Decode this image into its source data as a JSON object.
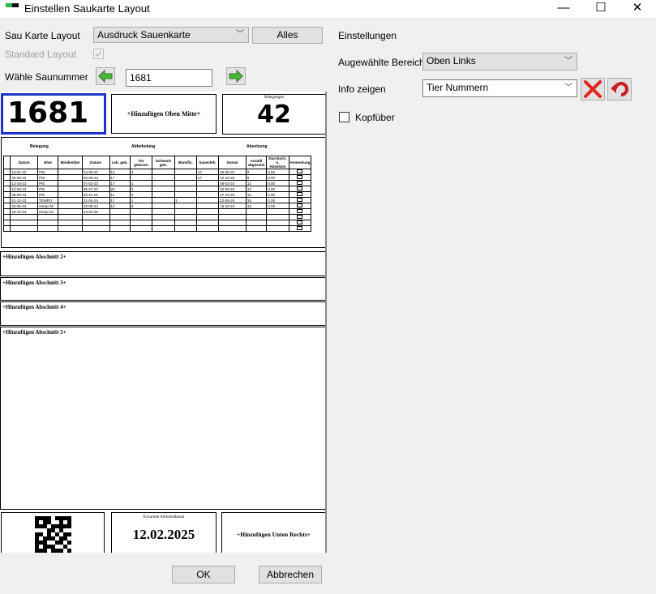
{
  "window": {
    "title": "Einstellen Saukarte Layout",
    "min": "—",
    "max": "☐",
    "close": "✕"
  },
  "left": {
    "layout_label": "Sau Karte Layout",
    "layout_value": "Ausdruck Sauenkarte",
    "alles": "Alles",
    "standard_label": "Standard Layout",
    "choose_label": "Wähle Saunummer",
    "sow_number": "1681"
  },
  "right": {
    "settings_label": "Einstellungen",
    "area_label": "Augewählte Bereiche",
    "area_value": "Oben Links",
    "info_label": "Info zeigen",
    "info_value": "Tier Nummern",
    "flip_label": "Kopfüber"
  },
  "card": {
    "top_left": "1681",
    "top_center": "+Hinzufügen Oben Mitte+",
    "top_right_caption": "Belegungen",
    "top_right_value": "42",
    "table": {
      "groups": [
        "Belegung",
        "Abferkelung",
        "Absetzung"
      ],
      "headers": [
        "Datum",
        "Eber",
        "Mindestber",
        "Datum",
        "Leb. geb.",
        "Tot geboren",
        "Schwach geb.",
        "Mumifiz.",
        "Sauenfeh.",
        "Datum",
        "Anzahl abgesetzt",
        "Durchsch. n. Absetzen",
        "Anmerkung"
      ],
      "rows": [
        [
          "10-01-22",
          "PIE",
          "",
          "04-05-22",
          "12",
          "4",
          "",
          "",
          "12",
          "25-05-22",
          "8",
          "6.65"
        ],
        [
          "30-05-22",
          "PIE",
          "",
          "20-09-22",
          "17",
          "",
          "",
          "",
          "17",
          "12-10-22",
          "9",
          "8.00"
        ],
        [
          "13-10-22",
          "PIE",
          "",
          "07-02-23",
          "17",
          "1",
          "",
          "",
          "",
          "08-03-23",
          "11",
          "0.00"
        ],
        [
          "12-03-23",
          "PIE",
          "",
          "05-07-23",
          "20",
          "3",
          "",
          "",
          "",
          "02-08-23",
          "13",
          "0.00"
        ],
        [
          "08-08-23",
          "PIE",
          "",
          "28-11-23",
          "11",
          "4",
          "",
          "",
          "",
          "27-12-23",
          "13",
          "0.00"
        ],
        [
          "31-12-23",
          "TEMPO",
          "",
          "21-04-24",
          "17",
          "1",
          "",
          "1",
          "",
          "22-05-24",
          "15",
          "0.00"
        ],
        [
          "26-05-24",
          "tempo M",
          "",
          "18-09-24",
          "13",
          "3",
          "",
          "",
          "",
          "16-10-24",
          "15",
          "0.00"
        ],
        [
          "20-10-24",
          "tempo M",
          "",
          "13-02-25",
          "",
          "",
          "",
          "",
          "",
          "",
          "",
          ""
        ]
      ]
    },
    "sections": [
      "+Hinzufügen Abschnitt 2+",
      "+Hinzufügen Abschnitt 3+",
      "+Hinzufügen Abschnitt 4+",
      "+Hinzufügen Abschnitt 5+"
    ],
    "bottom_center_caption": "Erwartete Abferkeldatum",
    "bottom_center_value": "12.02.2025",
    "bottom_right": "+Hinzufügen Unten Rechts+"
  },
  "buttons": {
    "ok": "OK",
    "cancel": "Abbrechen"
  },
  "colors": {
    "selection_border": "#1f32c8",
    "arrow_green": "#49b33b",
    "delete_red": "#e0241b"
  },
  "icons": [
    "left-arrow-icon",
    "right-arrow-icon",
    "delete-icon",
    "undo-icon",
    "qr-code-icon"
  ]
}
